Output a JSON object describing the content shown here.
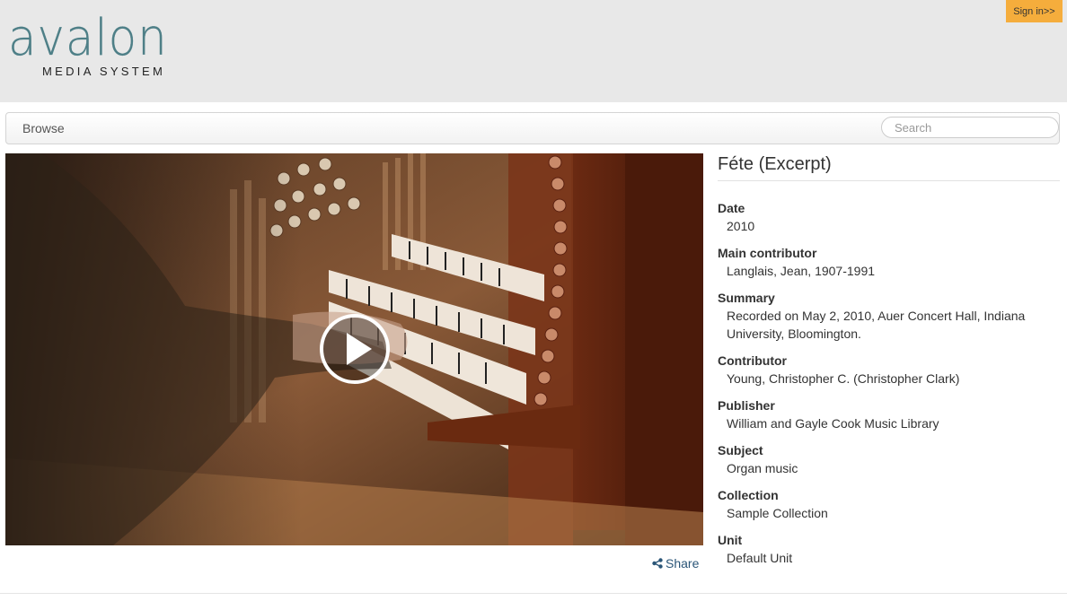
{
  "header": {
    "logo_word": "avalon",
    "logo_sub": "MEDIA SYSTEM",
    "signin_label": "Sign in>>"
  },
  "nav": {
    "browse_label": "Browse",
    "search_placeholder": "Search"
  },
  "player": {
    "poster_description_icon": "video-poster",
    "play_icon": "play-circle-icon"
  },
  "share": {
    "label": "Share",
    "icon": "share-icon"
  },
  "item": {
    "title": "Féte (Excerpt)",
    "fields": [
      {
        "label": "Date",
        "value": "2010"
      },
      {
        "label": "Main contributor",
        "value": "Langlais, Jean, 1907-1991"
      },
      {
        "label": "Summary",
        "value": "Recorded on May 2, 2010, Auer Concert Hall, Indiana University, Bloomington."
      },
      {
        "label": "Contributor",
        "value": "Young, Christopher C. (Christopher Clark)"
      },
      {
        "label": "Publisher",
        "value": "William and Gayle Cook Music Library"
      },
      {
        "label": "Subject",
        "value": "Organ music"
      },
      {
        "label": "Collection",
        "value": "Sample Collection"
      },
      {
        "label": "Unit",
        "value": "Default Unit"
      }
    ]
  },
  "colors": {
    "header_bg": "#e8e8e8",
    "logo": "#4e7f87",
    "signin_bg": "#f5ad3c",
    "share_link": "#2a5577"
  }
}
